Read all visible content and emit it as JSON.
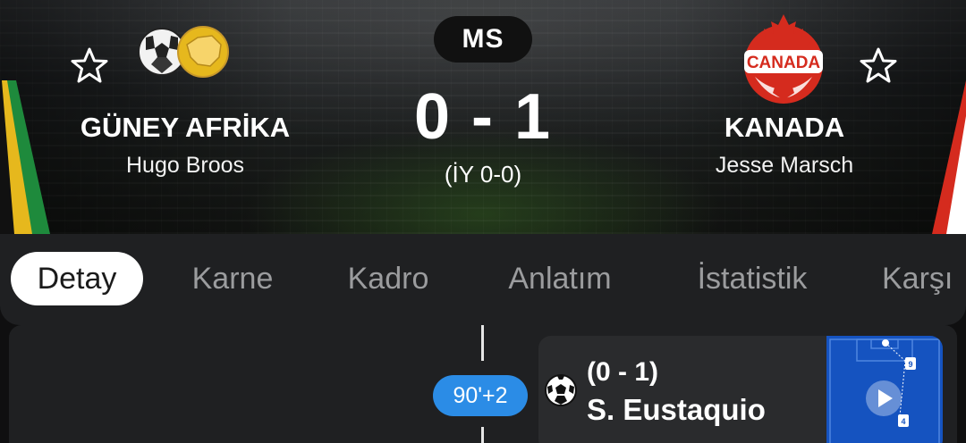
{
  "match": {
    "status": "MS",
    "score": "0 - 1",
    "halftime": "(İY 0-0)"
  },
  "home": {
    "name": "GÜNEY AFRİKA",
    "coach": "Hugo Broos",
    "crest_icon": "south-africa-crest-icon"
  },
  "away": {
    "name": "KANADA",
    "coach": "Jesse Marsch",
    "crest_text": "CANADA",
    "crest_icon": "canada-crest-icon"
  },
  "tabs": [
    {
      "label": "Detay",
      "active": true
    },
    {
      "label": "Karne",
      "active": false
    },
    {
      "label": "Kadro",
      "active": false
    },
    {
      "label": "Anlatım",
      "active": false
    },
    {
      "label": "İstatistik",
      "active": false
    },
    {
      "label": "Karşı",
      "active": false
    }
  ],
  "event": {
    "minute": "90'+2",
    "score": "(0 - 1)",
    "player": "S. Eustaquio",
    "icon": "soccer-ball-icon",
    "pitch_players": [
      "9",
      "4"
    ]
  },
  "colors": {
    "accent_blue": "#2b8ce6",
    "pitch_blue": "#1553c0",
    "canada_red": "#d52b1e",
    "sa_green": "#1e8a3c",
    "sa_gold": "#e6b81d"
  }
}
